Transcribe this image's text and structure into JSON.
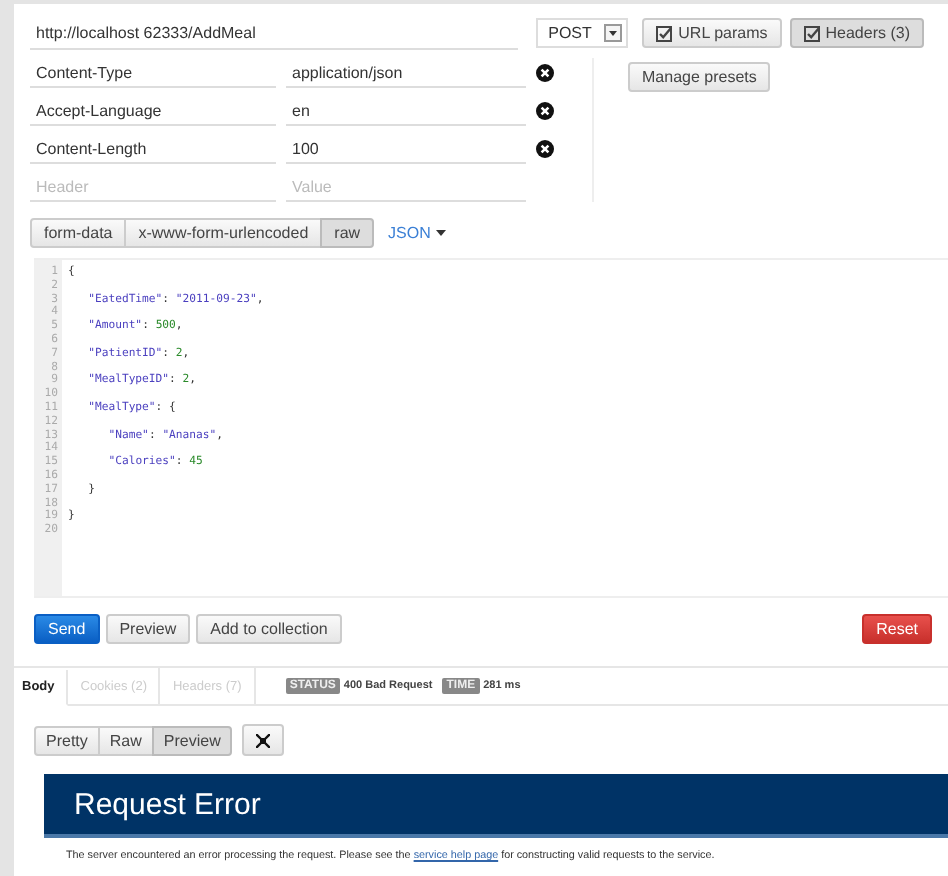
{
  "request": {
    "url": "http://localhost 62333/AddMeal",
    "method": "POST",
    "url_params_button": "URL params",
    "headers_button": "Headers (3)",
    "headers_button_selected": true
  },
  "headers": [
    {
      "key": "Content-Type",
      "value": "application/json",
      "removable": true
    },
    {
      "key": "Accept-Language",
      "value": "en",
      "removable": true
    },
    {
      "key": "Content-Length",
      "value": "100",
      "removable": true
    },
    {
      "key_placeholder": "Header",
      "value_placeholder": "Value",
      "removable": false
    }
  ],
  "manage_presets_button": "Manage presets",
  "body_modes": [
    {
      "label": "form-data",
      "selected": false
    },
    {
      "label": "x-www-form-urlencoded",
      "selected": false
    },
    {
      "label": "raw",
      "selected": true
    }
  ],
  "body_format": "JSON",
  "editor_lines": [
    {
      "number": "1",
      "code": "{"
    },
    {
      "number": "2"
    },
    {
      "number": "3",
      "code": "   \"EatedTime\": \"2011-09-23\","
    },
    {
      "number": "4"
    },
    {
      "number": "5",
      "code": "   \"Amount\": 500,"
    },
    {
      "number": "6"
    },
    {
      "number": "7",
      "code": "   \"PatientID\": 2,"
    },
    {
      "number": "8"
    },
    {
      "number": "9",
      "code": "   \"MealTypeID\": 2,"
    },
    {
      "number": "10"
    },
    {
      "number": "11",
      "code": "   \"MealType\": {"
    },
    {
      "number": "12"
    },
    {
      "number": "13",
      "code": "      \"Name\": \"Ananas\","
    },
    {
      "number": "14"
    },
    {
      "number": "15",
      "code": "      \"Calories\": 45"
    },
    {
      "number": "16"
    },
    {
      "number": "17",
      "code": "   }"
    },
    {
      "number": "18"
    },
    {
      "number": "19",
      "code": "}"
    },
    {
      "number": "20"
    }
  ],
  "actions": [
    {
      "label": "Send",
      "kind": "primary"
    },
    {
      "label": "Preview",
      "kind": "default"
    },
    {
      "label": "Add to collection",
      "kind": "default"
    },
    {
      "label": "Reset",
      "kind": "danger"
    }
  ],
  "response_tabs": [
    {
      "label": "Body",
      "selected": true
    },
    {
      "label": "Cookies (2)",
      "selected": false
    },
    {
      "label": "Headers (7)",
      "selected": false
    }
  ],
  "status": {
    "label": "STATUS",
    "value": "400 Bad Request"
  },
  "time": {
    "label": "TIME",
    "value": "281 ms"
  },
  "view_modes": [
    {
      "label": "Pretty",
      "selected": false
    },
    {
      "label": "Raw",
      "selected": false
    },
    {
      "label": "Preview",
      "selected": true
    }
  ],
  "preview": {
    "title": "Request Error",
    "text_before": "The server encountered an error processing the request. Please see the ",
    "link": "service help page",
    "text_after": " for constructing valid requests to the service."
  }
}
